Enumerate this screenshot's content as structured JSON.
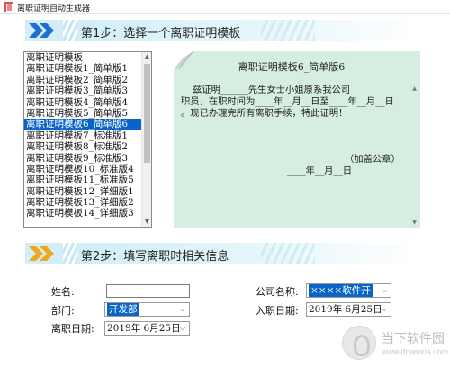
{
  "window": {
    "title": "离职证明自动生成器"
  },
  "step1": {
    "title": "第1步：选择一个离职证明模板"
  },
  "template_list": {
    "items": [
      "离职证明模板",
      "离职证明模板1_简单版1",
      "离职证明模板2_简单版2",
      "离职证明模板3_简单版3",
      "离职证明模板4_简单版4",
      "离职证明模板5_简单版5",
      "离职证明模板6_简单版6",
      "离职证明模板7_标准版1",
      "离职证明模板8_标准版2",
      "离职证明模板9_标准版3",
      "离职证明模板10_标准版4",
      "离职证明模板11_标准版5",
      "离职证明模板12_详细版1",
      "离职证明模板13_详细版2",
      "离职证明模板14_详细版3"
    ],
    "selected_index": 6
  },
  "preview": {
    "title": "离职证明模板6_简单版6",
    "body": "    兹证明______先生女士小姐原系我公司\n职员，在职时间为____年__月__日至____年__月__日\n。现已办理完所有离职手续，特此证明！",
    "stamp": "（加盖公章）",
    "date": "____年__月__日"
  },
  "step2": {
    "title": "第2步：填写离职时相关信息"
  },
  "form": {
    "name_label": "姓名:",
    "name_value": "",
    "dept_label": "部门:",
    "dept_value": "开发部",
    "leave_date_label": "离职日期:",
    "leave_date_value": "2019年  6月25日",
    "company_label": "公司名称:",
    "company_value": "××××软件开",
    "join_date_label": "入职日期:",
    "join_date_value": "2019年  6月25日"
  },
  "watermark": {
    "text": "当下软件园",
    "subtext": "www.downxia.com"
  },
  "colors": {
    "selection": "#0a64c8",
    "preview_bg": "#d6ede2",
    "banner": "#b9e4f2",
    "arrows": "#1e6fd0"
  },
  "icons": {
    "app": "certificate-icon",
    "banner": "double-chevron-icon",
    "dropdown": "chevron-down-icon"
  }
}
